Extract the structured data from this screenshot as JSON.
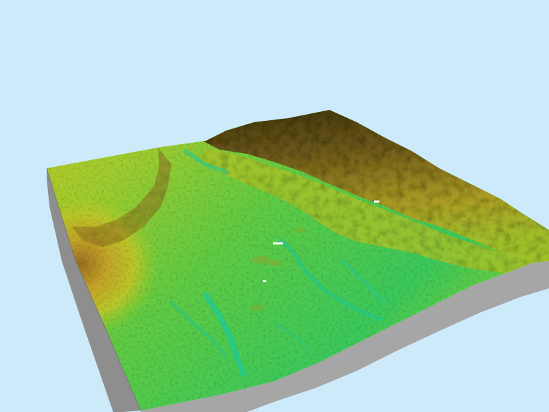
{
  "scene": {
    "view": "3d-perspective-terrain-block",
    "sky_color": "#cdeafb",
    "base_color": "#a6a6a6",
    "base_shade_color": "#8e8e8e",
    "colormap": {
      "low": "#22cc88",
      "mid_low": "#44c655",
      "mid": "#7fcc33",
      "mid_high": "#c8c52a",
      "high": "#8a6a1e",
      "peak": "#3f3514"
    },
    "features": [
      {
        "name": "mountain-range",
        "side": "back-right",
        "relief": "high"
      },
      {
        "name": "plateau",
        "side": "left",
        "relief": "medium"
      },
      {
        "name": "valley-plain",
        "side": "center",
        "relief": "low"
      },
      {
        "name": "drainage-channels",
        "side": "front-center",
        "relief": "low"
      }
    ]
  }
}
